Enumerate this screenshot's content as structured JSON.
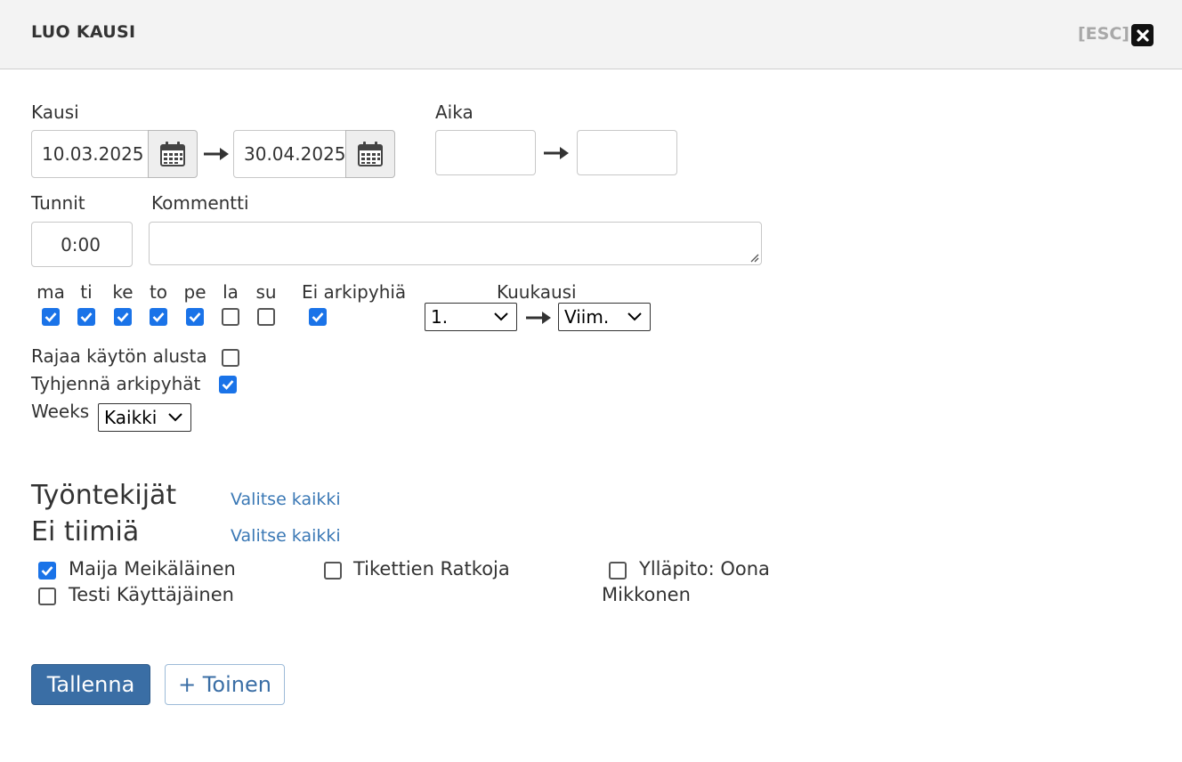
{
  "dialog": {
    "title": "LUO KAUSI",
    "esc_label": "[ESC]"
  },
  "period": {
    "label": "Kausi",
    "start_date": "10.03.2025",
    "end_date": "30.04.2025"
  },
  "time": {
    "label": "Aika",
    "start": "",
    "end": ""
  },
  "hours": {
    "label": "Tunnit",
    "value": "0:00"
  },
  "comment": {
    "label": "Kommentti",
    "value": ""
  },
  "weekdays": [
    {
      "label": "ma",
      "checked": true
    },
    {
      "label": "ti",
      "checked": true
    },
    {
      "label": "ke",
      "checked": true
    },
    {
      "label": "to",
      "checked": true
    },
    {
      "label": "pe",
      "checked": true
    },
    {
      "label": "la",
      "checked": false
    },
    {
      "label": "su",
      "checked": false
    }
  ],
  "no_holidays": {
    "label": "Ei arkipyhiä",
    "checked": true
  },
  "month": {
    "label": "Kuukausi",
    "from": "1.",
    "to": "Viim."
  },
  "limit_start": {
    "label": "Rajaa käytön alusta",
    "checked": false
  },
  "clear_holidays": {
    "label": "Tyhjennä arkipyhät",
    "checked": true
  },
  "weeks": {
    "label": "Weeks",
    "value": "Kaikki"
  },
  "employees": {
    "heading": "Työntekijät",
    "select_all": "Valitse kaikki",
    "team_heading": "Ei tiimiä",
    "team_select_all": "Valitse kaikki",
    "people": [
      {
        "name": "Maija Meikäläinen",
        "checked": true
      },
      {
        "name": "Tikettien Ratkoja",
        "checked": false
      },
      {
        "name": "Ylläpito: Oona",
        "name_line2": "Mikkonen",
        "checked": false
      },
      {
        "name": "Testi Käyttäjäinen",
        "checked": false
      }
    ]
  },
  "actions": {
    "save": "Tallenna",
    "another": "+ Toinen"
  },
  "colors": {
    "accent": "#3a6ea5",
    "checkbox": "#1a73e8",
    "link": "#3a78b5"
  }
}
